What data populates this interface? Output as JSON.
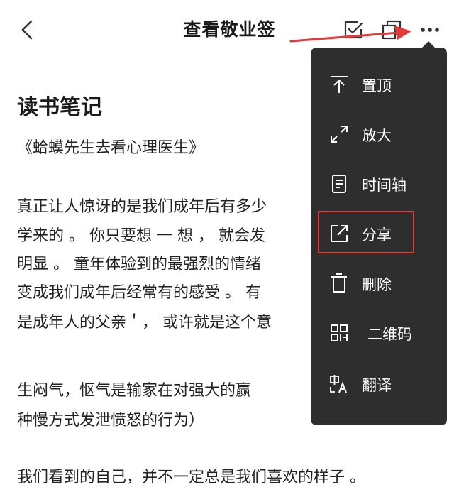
{
  "header": {
    "title": "查看敬业签"
  },
  "note": {
    "title": "读书笔记",
    "lines": [
      "《蛤蟆先生去看心理医生》",
      "真正让人惊讶的是我们成年后有多少",
      "学来的 。 你只要想 一 想 ， 就会发",
      "明显 。 童年体验到的最强烈的情绪",
      "变成我们成年后经常有的感受 。 有",
      "是成年人的父亲＇， 或许就是这个意",
      "生闷气，怄气是输家在对强大的赢",
      "种慢方式发泄愤怒的行为）",
      "我们看到的自己，并不一定总是我们喜欢的样子 。"
    ]
  },
  "menu": {
    "items": [
      {
        "label": "置顶",
        "icon": "pin-top-icon"
      },
      {
        "label": "放大",
        "icon": "expand-icon"
      },
      {
        "label": "时间轴",
        "icon": "document-icon"
      },
      {
        "label": "分享",
        "icon": "share-icon"
      },
      {
        "label": "删除",
        "icon": "trash-icon"
      },
      {
        "label": "二维码",
        "icon": "qr-code-icon"
      },
      {
        "label": "翻译",
        "icon": "translate-icon"
      }
    ]
  },
  "colors": {
    "menu_bg": "#2e2e2e",
    "annotation_red": "#e03a3a",
    "text": "#222222"
  }
}
